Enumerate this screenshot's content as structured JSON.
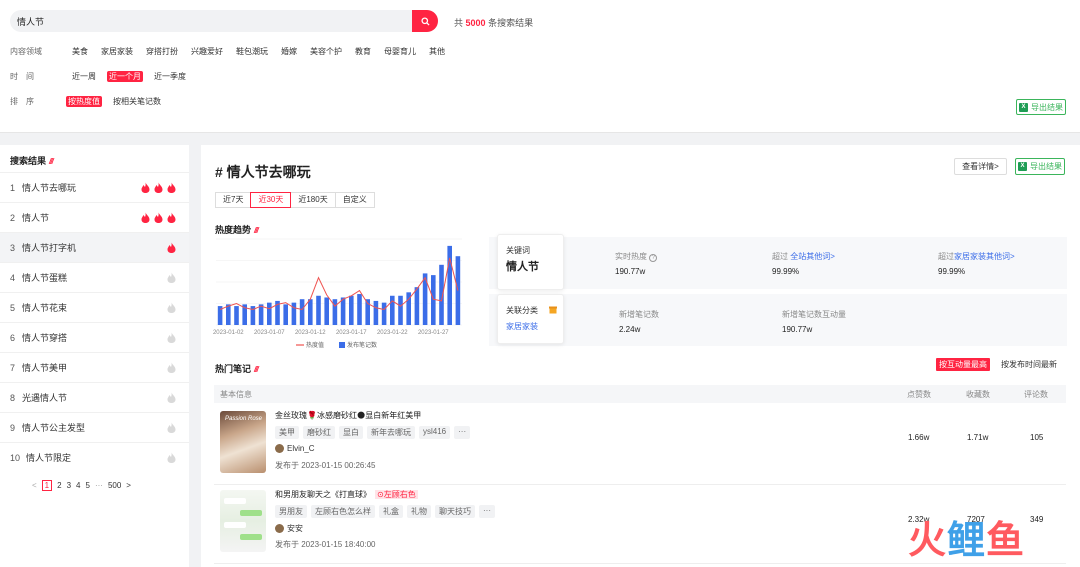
{
  "search": {
    "query": "情人节",
    "result_prefix": "共",
    "result_count": "5000",
    "result_suffix": "条搜索结果"
  },
  "filters": {
    "domain": {
      "label": "内容领域",
      "options": [
        "美食",
        "家居家装",
        "穿搭打扮",
        "兴趣爱好",
        "鞋包潮玩",
        "婚嫁",
        "美容个护",
        "教育",
        "母婴育儿",
        "其他"
      ]
    },
    "time": {
      "label": "时　间",
      "options": [
        "近一周",
        "近一个月",
        "近一季度"
      ],
      "active": 1
    },
    "sort": {
      "label": "排　序",
      "options": [
        "按热度值",
        "按相关笔记数"
      ],
      "active": 0
    }
  },
  "export_label": "导出结果",
  "left": {
    "title": "搜索结果",
    "items": [
      {
        "idx": "1",
        "label": "情人节去哪玩",
        "heat": 3
      },
      {
        "idx": "2",
        "label": "情人节",
        "heat": 3
      },
      {
        "idx": "3",
        "label": "情人节打字机",
        "heat": 1
      },
      {
        "idx": "4",
        "label": "情人节蛋糕",
        "heat": 0
      },
      {
        "idx": "5",
        "label": "情人节花束",
        "heat": 0
      },
      {
        "idx": "6",
        "label": "情人节穿搭",
        "heat": 0
      },
      {
        "idx": "7",
        "label": "情人节美甲",
        "heat": 0
      },
      {
        "idx": "8",
        "label": "光遇情人节",
        "heat": 0
      },
      {
        "idx": "9",
        "label": "情人节公主发型",
        "heat": 0
      },
      {
        "idx": "10",
        "label": "情人节限定",
        "heat": 0
      }
    ],
    "pager": {
      "prev": "<",
      "pages": [
        "1",
        "2",
        "3",
        "4",
        "5"
      ],
      "ellipsis": "···",
      "last": "500",
      "next": ">"
    }
  },
  "detail": {
    "title": "# 情人节去哪玩",
    "view_detail": "查看详情>",
    "tabs": [
      "近7天",
      "近30天",
      "近180天",
      "自定义"
    ],
    "active_tab": 1,
    "trend_title": "热度趋势",
    "keyword_card": {
      "label": "关键词",
      "value": "情人节"
    },
    "category_card": {
      "label": "关联分类",
      "value": "家居家装"
    },
    "metrics": {
      "realtime_label": "实时热度",
      "realtime_value": "190.77w",
      "over_all_prefix": "超过",
      "over_all_link": "全站其他词>",
      "over_all_value": "99.99%",
      "over_cat_prefix": "超过",
      "over_cat_link": "家居家装其他词>",
      "over_cat_value": "99.99%",
      "new_notes_label": "新增笔记数",
      "new_notes_value": "2.24w",
      "new_interact_label": "新增笔记数互动量",
      "new_interact_value": "190.77w"
    },
    "hot_title": "热门笔记",
    "sort_active": "按互动量最高",
    "sort_other": "按发布时间最新",
    "table_cols": {
      "info": "基本信息",
      "likes": "点赞数",
      "collects": "收藏数",
      "comments": "评论数"
    },
    "notes": [
      {
        "title": "金丝玫瑰🌹冰感磨砂红🌑显白新年红美甲",
        "tag": "",
        "chips": [
          "美甲",
          "磨砂红",
          "显白",
          "新年去哪玩",
          "ysl416",
          "···"
        ],
        "author": "Elvin_C",
        "time": "发布于 2023-01-15 00:26:45",
        "likes": "1.66w",
        "collects": "1.71w",
        "comments": "105",
        "thumb_text": "Passion Rose"
      },
      {
        "title": "和男朋友聊天之《打直球》",
        "tag": "⊙左顾右色",
        "chips": [
          "男朋友",
          "左顾右色怎么样",
          "礼盒",
          "礼物",
          "聊天技巧",
          "···"
        ],
        "author": "安安",
        "time": "发布于 2023-01-15 18:40:00",
        "likes": "2.32w",
        "collects": "7207",
        "comments": "349",
        "thumb_text": ""
      }
    ]
  },
  "chart_data": {
    "type": "bar",
    "title": "",
    "x": [
      "2023-01-01",
      "2023-01-02",
      "2023-01-03",
      "2023-01-04",
      "2023-01-05",
      "2023-01-06",
      "2023-01-07",
      "2023-01-08",
      "2023-01-09",
      "2023-01-10",
      "2023-01-11",
      "2023-01-12",
      "2023-01-13",
      "2023-01-14",
      "2023-01-15",
      "2023-01-16",
      "2023-01-17",
      "2023-01-18",
      "2023-01-19",
      "2023-01-20",
      "2023-01-21",
      "2023-01-22",
      "2023-01-23",
      "2023-01-24",
      "2023-01-25",
      "2023-01-26",
      "2023-01-27",
      "2023-01-28",
      "2023-01-29",
      "2023-01-30"
    ],
    "tick_labels": [
      "2023-01-02",
      "2023-01-07",
      "2023-01-12",
      "2023-01-17",
      "2023-01-22",
      "2023-01-27"
    ],
    "series": [
      {
        "name": "热度值",
        "type": "line",
        "color": "#ef5350",
        "values": [
          18,
          22,
          25,
          20,
          18,
          22,
          19,
          24,
          26,
          20,
          18,
          30,
          55,
          35,
          22,
          30,
          34,
          40,
          25,
          20,
          18,
          28,
          22,
          30,
          42,
          55,
          30,
          28,
          78,
          40
        ]
      },
      {
        "name": "发布笔记数",
        "type": "bar",
        "color": "#3b6de8",
        "values": [
          22,
          24,
          22,
          24,
          22,
          24,
          26,
          28,
          24,
          26,
          30,
          30,
          34,
          32,
          30,
          32,
          34,
          36,
          30,
          28,
          26,
          34,
          34,
          38,
          44,
          60,
          58,
          70,
          92,
          80
        ]
      }
    ],
    "ylim": [
      0,
      100
    ],
    "grid": true,
    "legend": "bottom"
  },
  "colors": {
    "brand": "#ff2442",
    "link": "#3b6de8",
    "excel": "#3bb55b"
  },
  "watermark": {
    "chars": [
      "火",
      "鲤",
      "鱼"
    ]
  }
}
